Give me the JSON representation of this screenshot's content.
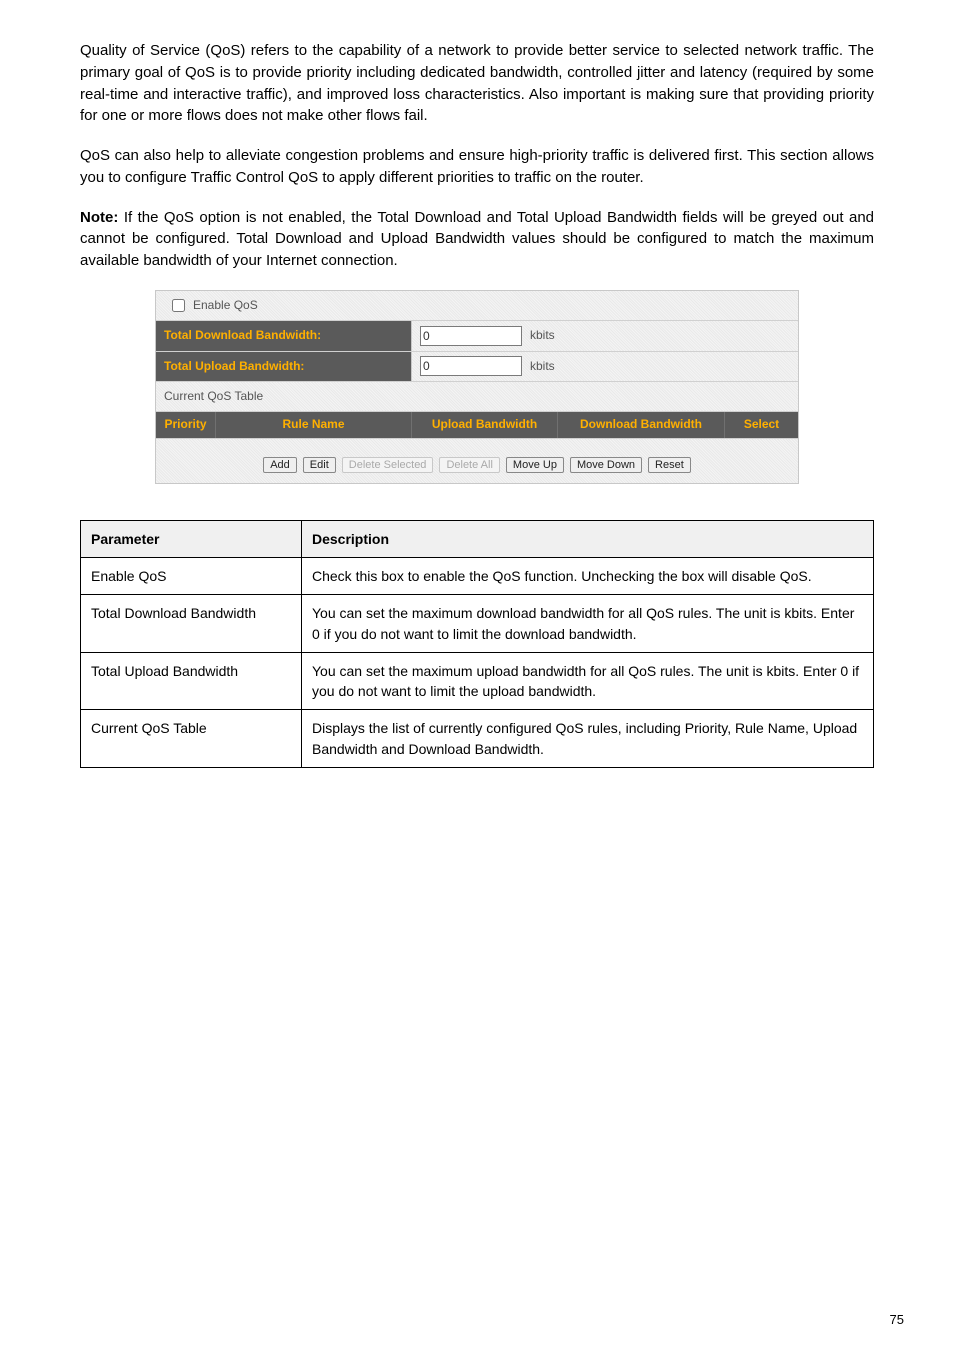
{
  "intro": "Quality of Service (QoS) refers to the capability of a network to provide better service to selected network traffic. The primary goal of QoS is to provide priority including dedicated bandwidth, controlled jitter and latency (required by some real-time and interactive traffic), and improved loss characteristics. Also important is making sure that providing priority for one or more flows does not make other flows fail.",
  "body": "QoS can also help to alleviate congestion problems and ensure high-priority traffic is delivered first. This section allows you to configure Traffic Control QoS to apply different priorities to traffic on the router.",
  "note_label": "Note",
  "note_text": "If the QoS option is not enabled, the Total Download and Total Upload Bandwidth fields will be greyed out and cannot be configured. Total Download and Upload Bandwidth values should be configured to match the maximum available bandwidth of your Internet connection.",
  "panel": {
    "enable_label": "Enable QoS",
    "download_label": "Total Download Bandwidth:",
    "upload_label": "Total Upload Bandwidth:",
    "download_value": "0",
    "upload_value": "0",
    "unit": "kbits",
    "table_title": "Current QoS Table",
    "head_priority": "Priority",
    "head_rulename": "Rule Name",
    "head_upload": "Upload Bandwidth",
    "head_download": "Download Bandwidth",
    "head_select": "Select",
    "btn_add": "Add",
    "btn_edit": "Edit",
    "btn_delete_selected": "Delete Selected",
    "btn_delete_all": "Delete All",
    "btn_move_up": "Move Up",
    "btn_move_down": "Move Down",
    "btn_reset": "Reset"
  },
  "desc": {
    "head_param": "Parameter",
    "head_desc": "Description",
    "rows": [
      {
        "param": "Enable QoS",
        "desc": "Check this box to enable the QoS function. Unchecking the box will disable QoS."
      },
      {
        "param": "Total Download Bandwidth",
        "desc": "You can set the maximum download bandwidth for all QoS rules. The unit is kbits. Enter 0 if you do not want to limit the download bandwidth."
      },
      {
        "param": "Total Upload Bandwidth",
        "desc": "You can set the maximum upload bandwidth for all QoS rules. The unit is kbits. Enter 0 if you do not want to limit the upload bandwidth."
      },
      {
        "param": "Current QoS Table",
        "desc": "Displays the list of currently configured QoS rules, including Priority, Rule Name, Upload Bandwidth and Download Bandwidth."
      }
    ]
  },
  "page_number": "75"
}
